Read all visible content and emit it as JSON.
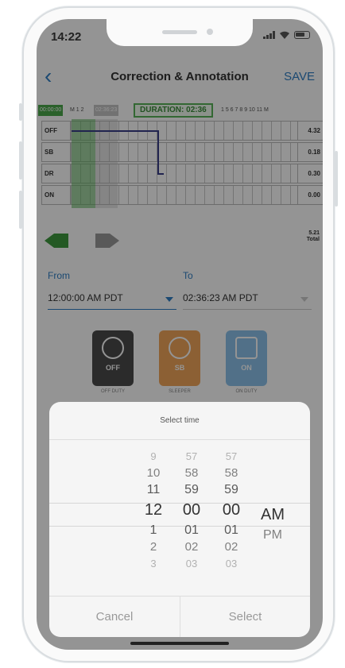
{
  "status_bar": {
    "time": "14:22"
  },
  "nav": {
    "title": "Correction & Annotation",
    "save_label": "SAVE"
  },
  "log": {
    "start_time_badge": "00:00:00",
    "end_time_badge": "02:36:23",
    "hour_labels_left": "M 1 2",
    "hour_labels_right": "1 5 6 7 8 9 10 11 M",
    "duration_label": "DURATION: 02:36",
    "rows": [
      {
        "label": "OFF",
        "total": "4.32"
      },
      {
        "label": "SB",
        "total": "0.18"
      },
      {
        "label": "DR",
        "total": "0.30"
      },
      {
        "label": "ON",
        "total": "0.00"
      }
    ],
    "grand_total_value": "5.21",
    "grand_total_label": "Total"
  },
  "range": {
    "from_label": "From",
    "from_value": "12:00:00 AM PDT",
    "to_label": "To",
    "to_value": "02:36:23 AM PDT"
  },
  "duty_status": [
    {
      "label": "OFF",
      "caption": "OFF DUTY",
      "color": "#4a4a4a",
      "icon": "power-icon"
    },
    {
      "label": "SB",
      "caption": "SLEEPER",
      "color": "#f2a65a",
      "icon": "sleep-bubble-icon"
    },
    {
      "label": "ON",
      "caption": "ON DUTY",
      "color": "#8cc2ea",
      "icon": "truck-icon"
    }
  ],
  "picker": {
    "title": "Select time",
    "hours": [
      "9",
      "10",
      "11",
      "12",
      "1",
      "2",
      "3"
    ],
    "minutes": [
      "57",
      "58",
      "59",
      "00",
      "01",
      "02",
      "03"
    ],
    "seconds": [
      "57",
      "58",
      "59",
      "00",
      "01",
      "02",
      "03"
    ],
    "ampm": [
      "AM",
      "PM"
    ],
    "selected": {
      "hour": "12",
      "minute": "00",
      "second": "00",
      "ampm": "AM"
    },
    "cancel_label": "Cancel",
    "select_label": "Select"
  },
  "colors": {
    "accent": "#2f7ec4",
    "selection_green": "#56b256",
    "duty_line": "#3a3f88"
  }
}
